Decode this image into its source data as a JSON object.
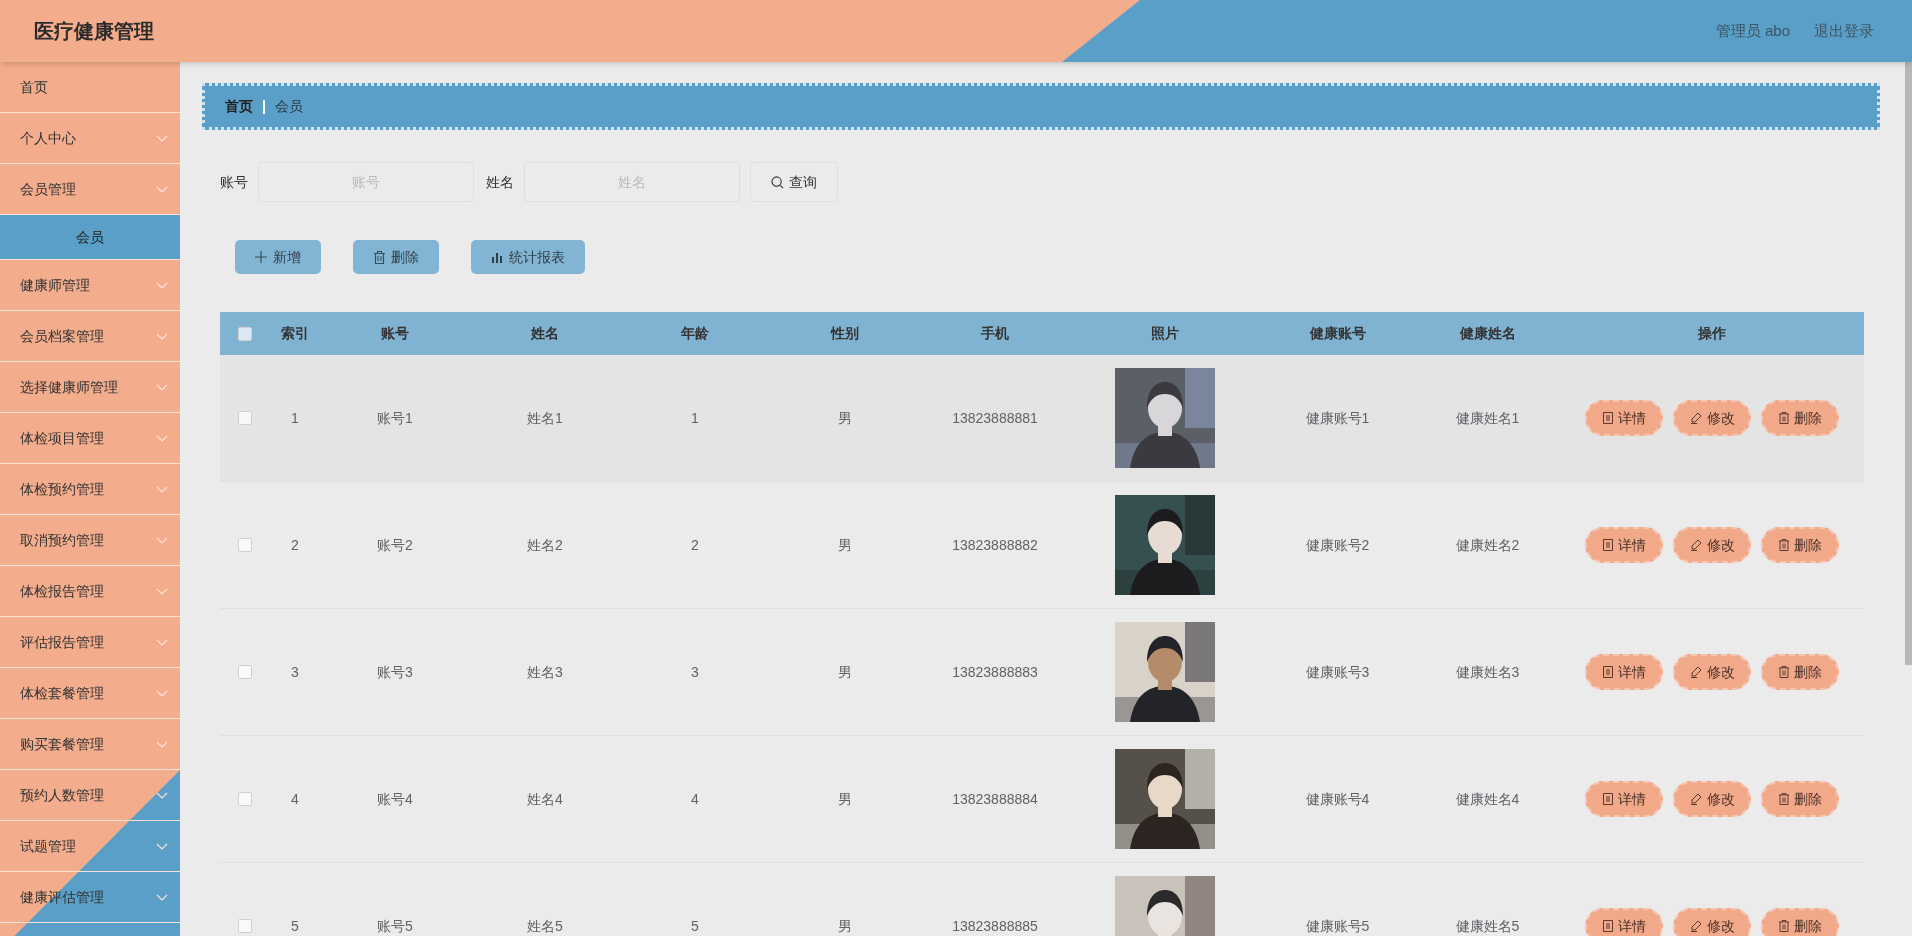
{
  "header": {
    "title": "医疗健康管理",
    "user": "管理员 abo",
    "logout": "退出登录"
  },
  "sidebar": {
    "items": [
      {
        "label": "首页",
        "kind": "link"
      },
      {
        "label": "个人中心",
        "kind": "menu"
      },
      {
        "label": "会员管理",
        "kind": "menu",
        "children": [
          {
            "label": "会员",
            "selected": true
          }
        ]
      },
      {
        "label": "健康师管理",
        "kind": "menu"
      },
      {
        "label": "会员档案管理",
        "kind": "menu"
      },
      {
        "label": "选择健康师管理",
        "kind": "menu"
      },
      {
        "label": "体检项目管理",
        "kind": "menu"
      },
      {
        "label": "体检预约管理",
        "kind": "menu"
      },
      {
        "label": "取消预约管理",
        "kind": "menu"
      },
      {
        "label": "体检报告管理",
        "kind": "menu"
      },
      {
        "label": "评估报告管理",
        "kind": "menu"
      },
      {
        "label": "体检套餐管理",
        "kind": "menu"
      },
      {
        "label": "购买套餐管理",
        "kind": "menu"
      },
      {
        "label": "预约人数管理",
        "kind": "menu"
      },
      {
        "label": "试题管理",
        "kind": "menu"
      },
      {
        "label": "健康评估管理",
        "kind": "menu"
      }
    ]
  },
  "breadcrumb": [
    "首页",
    "会员"
  ],
  "search": {
    "fields": [
      {
        "label": "账号",
        "placeholder": "账号"
      },
      {
        "label": "姓名",
        "placeholder": "姓名"
      }
    ],
    "button": "查询"
  },
  "toolbar": [
    {
      "kind": "add",
      "label": "新增"
    },
    {
      "kind": "delete",
      "label": "删除"
    },
    {
      "kind": "chart",
      "label": "统计报表"
    }
  ],
  "table": {
    "select_all": {
      "checked": false
    },
    "columns": [
      "索引",
      "账号",
      "姓名",
      "年龄",
      "性别",
      "手机",
      "照片",
      "健康账号",
      "健康姓名",
      "操作"
    ],
    "rows": [
      {
        "checked": false,
        "cells": [
          "1",
          "账号1",
          "姓名1",
          "1",
          "男",
          "13823888881",
          {
            "kind": "picture"
          },
          "健康账号1",
          "健康姓名1"
        ],
        "actions": [
          {
            "kind": "detail",
            "label": "详情"
          },
          {
            "kind": "edit",
            "label": "修改"
          },
          {
            "kind": "delete",
            "label": "删除"
          }
        ]
      },
      {
        "checked": false,
        "cells": [
          "2",
          "账号2",
          "姓名2",
          "2",
          "男",
          "13823888882",
          {
            "kind": "picture"
          },
          "健康账号2",
          "健康姓名2"
        ],
        "actions": [
          {
            "kind": "detail",
            "label": "详情"
          },
          {
            "kind": "edit",
            "label": "修改"
          },
          {
            "kind": "delete",
            "label": "删除"
          }
        ]
      },
      {
        "checked": false,
        "cells": [
          "3",
          "账号3",
          "姓名3",
          "3",
          "男",
          "13823888883",
          {
            "kind": "picture"
          },
          "健康账号3",
          "健康姓名3"
        ],
        "actions": [
          {
            "kind": "detail",
            "label": "详情"
          },
          {
            "kind": "edit",
            "label": "修改"
          },
          {
            "kind": "delete",
            "label": "删除"
          }
        ]
      },
      {
        "checked": false,
        "cells": [
          "4",
          "账号4",
          "姓名4",
          "4",
          "男",
          "13823888884",
          {
            "kind": "picture"
          },
          "健康账号4",
          "健康姓名4"
        ],
        "actions": [
          {
            "kind": "detail",
            "label": "详情"
          },
          {
            "kind": "edit",
            "label": "修改"
          },
          {
            "kind": "delete",
            "label": "删除"
          }
        ]
      },
      {
        "checked": false,
        "cells": [
          "5",
          "账号5",
          "姓名5",
          "5",
          "男",
          "13823888885",
          {
            "kind": "picture"
          },
          "健康账号5",
          "健康姓名5"
        ],
        "actions": [
          {
            "kind": "detail",
            "label": "详情"
          },
          {
            "kind": "edit",
            "label": "修改"
          },
          {
            "kind": "delete",
            "label": "删除"
          }
        ]
      }
    ]
  }
}
